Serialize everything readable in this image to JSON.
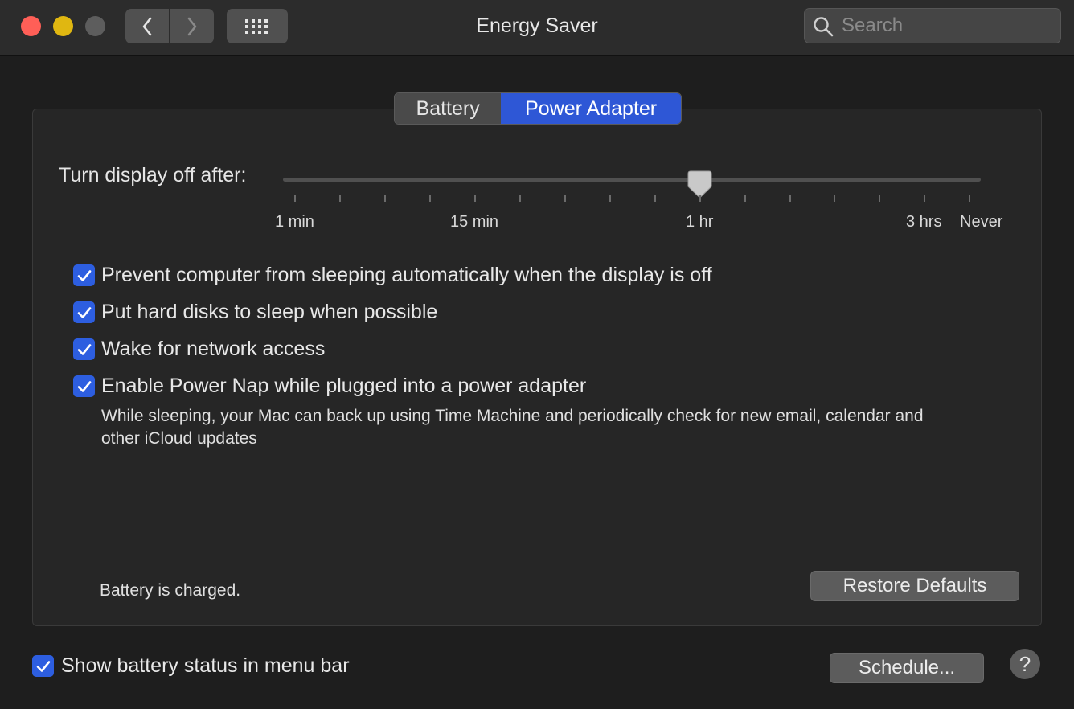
{
  "window": {
    "title": "Energy Saver",
    "search_placeholder": "Search"
  },
  "tabs": [
    {
      "label": "Battery",
      "selected": false
    },
    {
      "label": "Power Adapter",
      "selected": true
    }
  ],
  "slider": {
    "label": "Turn display off after:",
    "tick_labels": [
      "1 min",
      "15 min",
      "1 hr",
      "3 hrs",
      "Never"
    ],
    "selected_value": "1 hr"
  },
  "options": [
    {
      "label": "Prevent computer from sleeping automatically when the display is off",
      "checked": true
    },
    {
      "label": "Put hard disks to sleep when possible",
      "checked": true
    },
    {
      "label": "Wake for network access",
      "checked": true
    },
    {
      "label": "Enable Power Nap while plugged into a power adapter",
      "checked": true
    }
  ],
  "power_nap_description": "While sleeping, your Mac can back up using Time Machine and periodically check for new email, calendar and other iCloud updates",
  "status_text": "Battery is charged.",
  "buttons": {
    "restore_defaults": "Restore Defaults",
    "schedule": "Schedule...",
    "help": "?"
  },
  "menu_bar_option": {
    "label": "Show battery status in menu bar",
    "checked": true
  },
  "colors": {
    "accent": "#2e57d6",
    "close": "#ff5f57",
    "minimize": "#e0b711",
    "background": "#1e1e1e"
  }
}
